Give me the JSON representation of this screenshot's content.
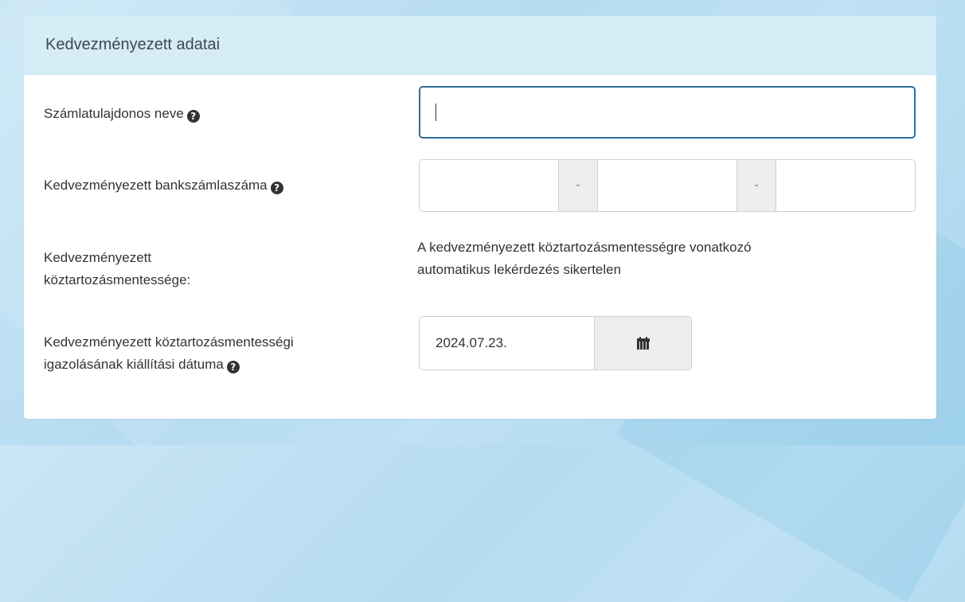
{
  "panel": {
    "title": "Kedvezményezett adatai"
  },
  "fields": {
    "account_holder": {
      "label": "Számlatulajdonos neve",
      "value": "",
      "help_icon": "question-circle-icon"
    },
    "account_number": {
      "label": "Kedvezményezett bankszámlaszáma",
      "separator": "-",
      "segments": [
        "",
        "",
        ""
      ],
      "help_icon": "question-circle-icon"
    },
    "tax_exemption": {
      "label_line1": "Kedvezményezett",
      "label_line2": "köztartozásmentessége:",
      "text_line1": "A kedvezményezett köztartozásmentességre vonatkozó",
      "text_line2": "automatikus lekérdezés sikertelen"
    },
    "certificate_date": {
      "label_line1": "Kedvezményezett köztartozásmentességi",
      "label_line2": "igazolásának kiállítási dátuma",
      "value": "2024.07.23.",
      "help_icon": "question-circle-icon",
      "button_icon": "calendar-icon"
    }
  },
  "colors": {
    "header_bg": "#d6ecf7",
    "focus_border": "#2f6f9b",
    "page_bg": "#b6dcf1"
  }
}
